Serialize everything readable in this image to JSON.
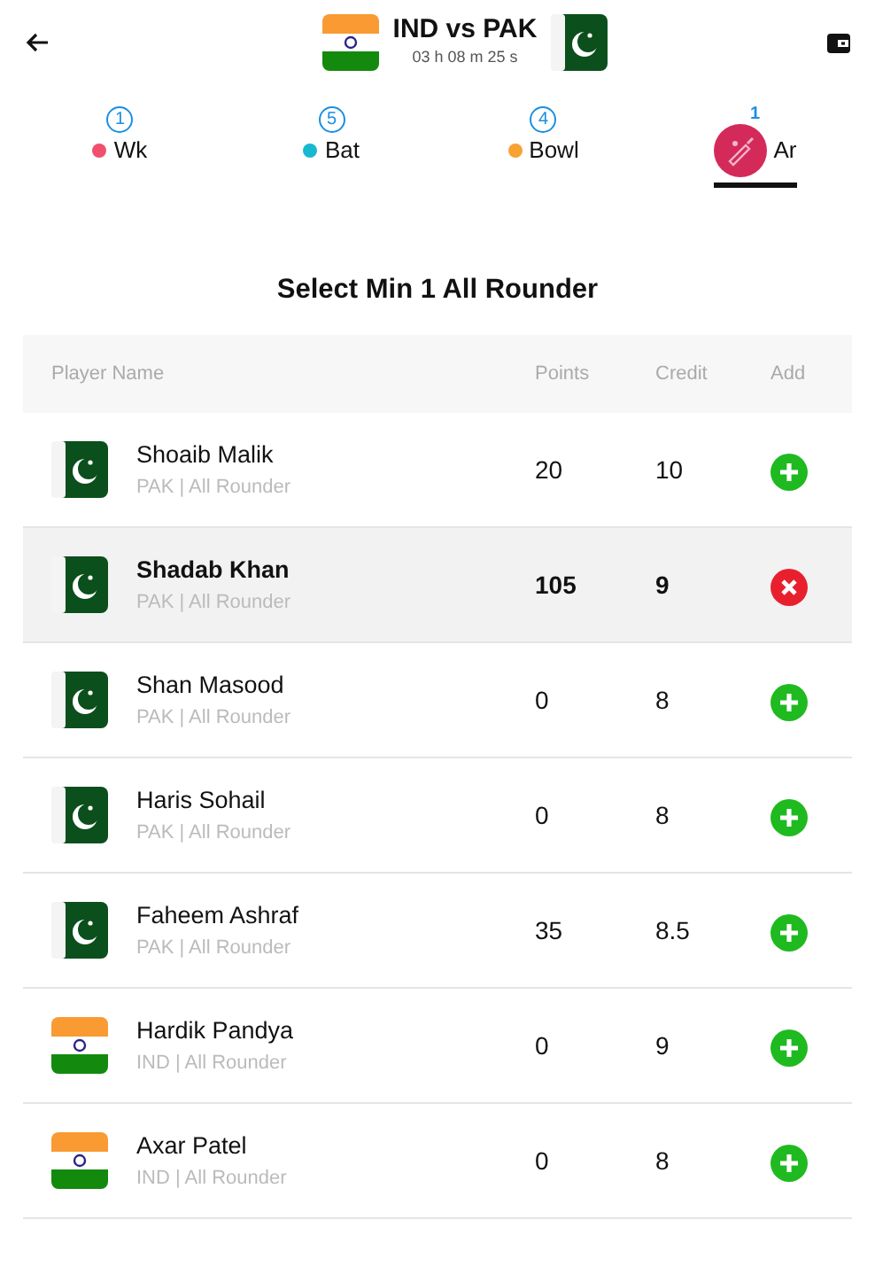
{
  "header": {
    "title": "IND vs PAK",
    "countdown": "03 h 08 m 25 s",
    "flags": [
      {
        "kind": "india"
      },
      {
        "kind": "pakistan"
      }
    ]
  },
  "tabs": [
    {
      "count": "1",
      "label": "Wk",
      "color": "#f0506e",
      "selected": false
    },
    {
      "count": "5",
      "label": "Bat",
      "color": "#17b8d1",
      "selected": false
    },
    {
      "count": "4",
      "label": "Bowl",
      "color": "#f7a233",
      "selected": false
    },
    {
      "count": "1",
      "label": "Ar",
      "color": "#d42a5a",
      "selected": true
    }
  ],
  "section_title": "Select Min 1 All Rounder",
  "table": {
    "columns": [
      "Player Name",
      "Points",
      "Credit",
      "Add"
    ],
    "rows": [
      {
        "kind": "pakistan",
        "name": "Shoaib Malik",
        "subtitle": "PAK | All Rounder",
        "points": "20",
        "credit": "10",
        "selected": false
      },
      {
        "kind": "pakistan",
        "name": "Shadab Khan",
        "subtitle": "PAK | All Rounder",
        "points": "105",
        "credit": "9",
        "selected": true
      },
      {
        "kind": "pakistan",
        "name": "Shan Masood",
        "subtitle": "PAK | All Rounder",
        "points": "0",
        "credit": "8",
        "selected": false
      },
      {
        "kind": "pakistan",
        "name": "Haris Sohail",
        "subtitle": "PAK | All Rounder",
        "points": "0",
        "credit": "8",
        "selected": false
      },
      {
        "kind": "pakistan",
        "name": "Faheem Ashraf",
        "subtitle": "PAK | All Rounder",
        "points": "35",
        "credit": "8.5",
        "selected": false
      },
      {
        "kind": "india",
        "name": "Hardik Pandya",
        "subtitle": "IND | All Rounder",
        "points": "0",
        "credit": "9",
        "selected": false
      },
      {
        "kind": "india",
        "name": "Axar Patel",
        "subtitle": "IND | All Rounder",
        "points": "0",
        "credit": "8",
        "selected": false
      }
    ]
  }
}
